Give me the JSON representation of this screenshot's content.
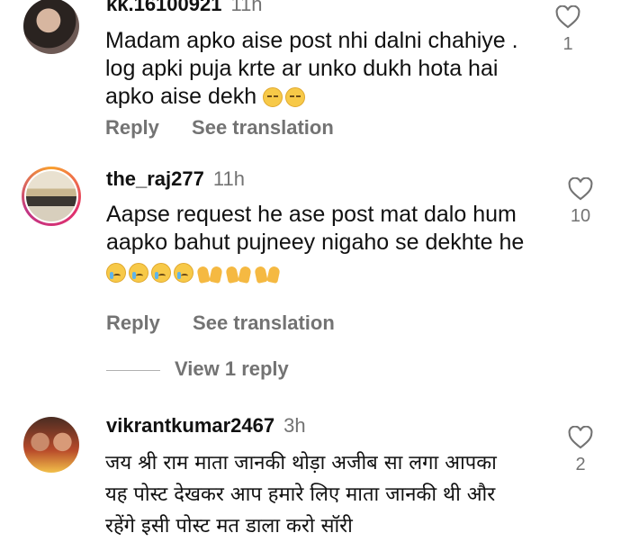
{
  "comments": [
    {
      "username": "kk.16100921",
      "time": "11h",
      "text_lines": [
        "Madam apko aise post  nhi dalni chahiye .",
        "log apki  puja krte ar unko dukh hota hai",
        "apko aise dekh"
      ],
      "emojis": [
        "sad-face",
        "sad-face"
      ],
      "reply_label": "Reply",
      "translate_label": "See translation",
      "likes": "1"
    },
    {
      "username": "the_raj277",
      "time": "11h",
      "text_lines": [
        "Aapse request he ase post mat dalo hum",
        "aapko bahut pujneey nigaho se dekhte he"
      ],
      "emojis": [
        "crying-face",
        "crying-face",
        "crying-face",
        "crying-face",
        "raising-hands",
        "raising-hands",
        "raising-hands"
      ],
      "reply_label": "Reply",
      "translate_label": "See translation",
      "likes": "10",
      "view_replies": "View 1 reply"
    },
    {
      "username": "vikrantkumar2467",
      "time": "3h",
      "text_lines": [
        "जय श्री राम माता जानकी थोड़ा अजीब सा लगा आपका",
        "यह पोस्ट देखकर आप हमारे लिए माता जानकी थी और",
        "रहेंगे इसी पोस्ट मत डाला करो सॉरी"
      ],
      "likes": "2"
    }
  ],
  "colors": {
    "secondary_text": "#737373",
    "story_ring": "#e1306c"
  },
  "icons": {
    "like": "heart-outline-icon"
  }
}
